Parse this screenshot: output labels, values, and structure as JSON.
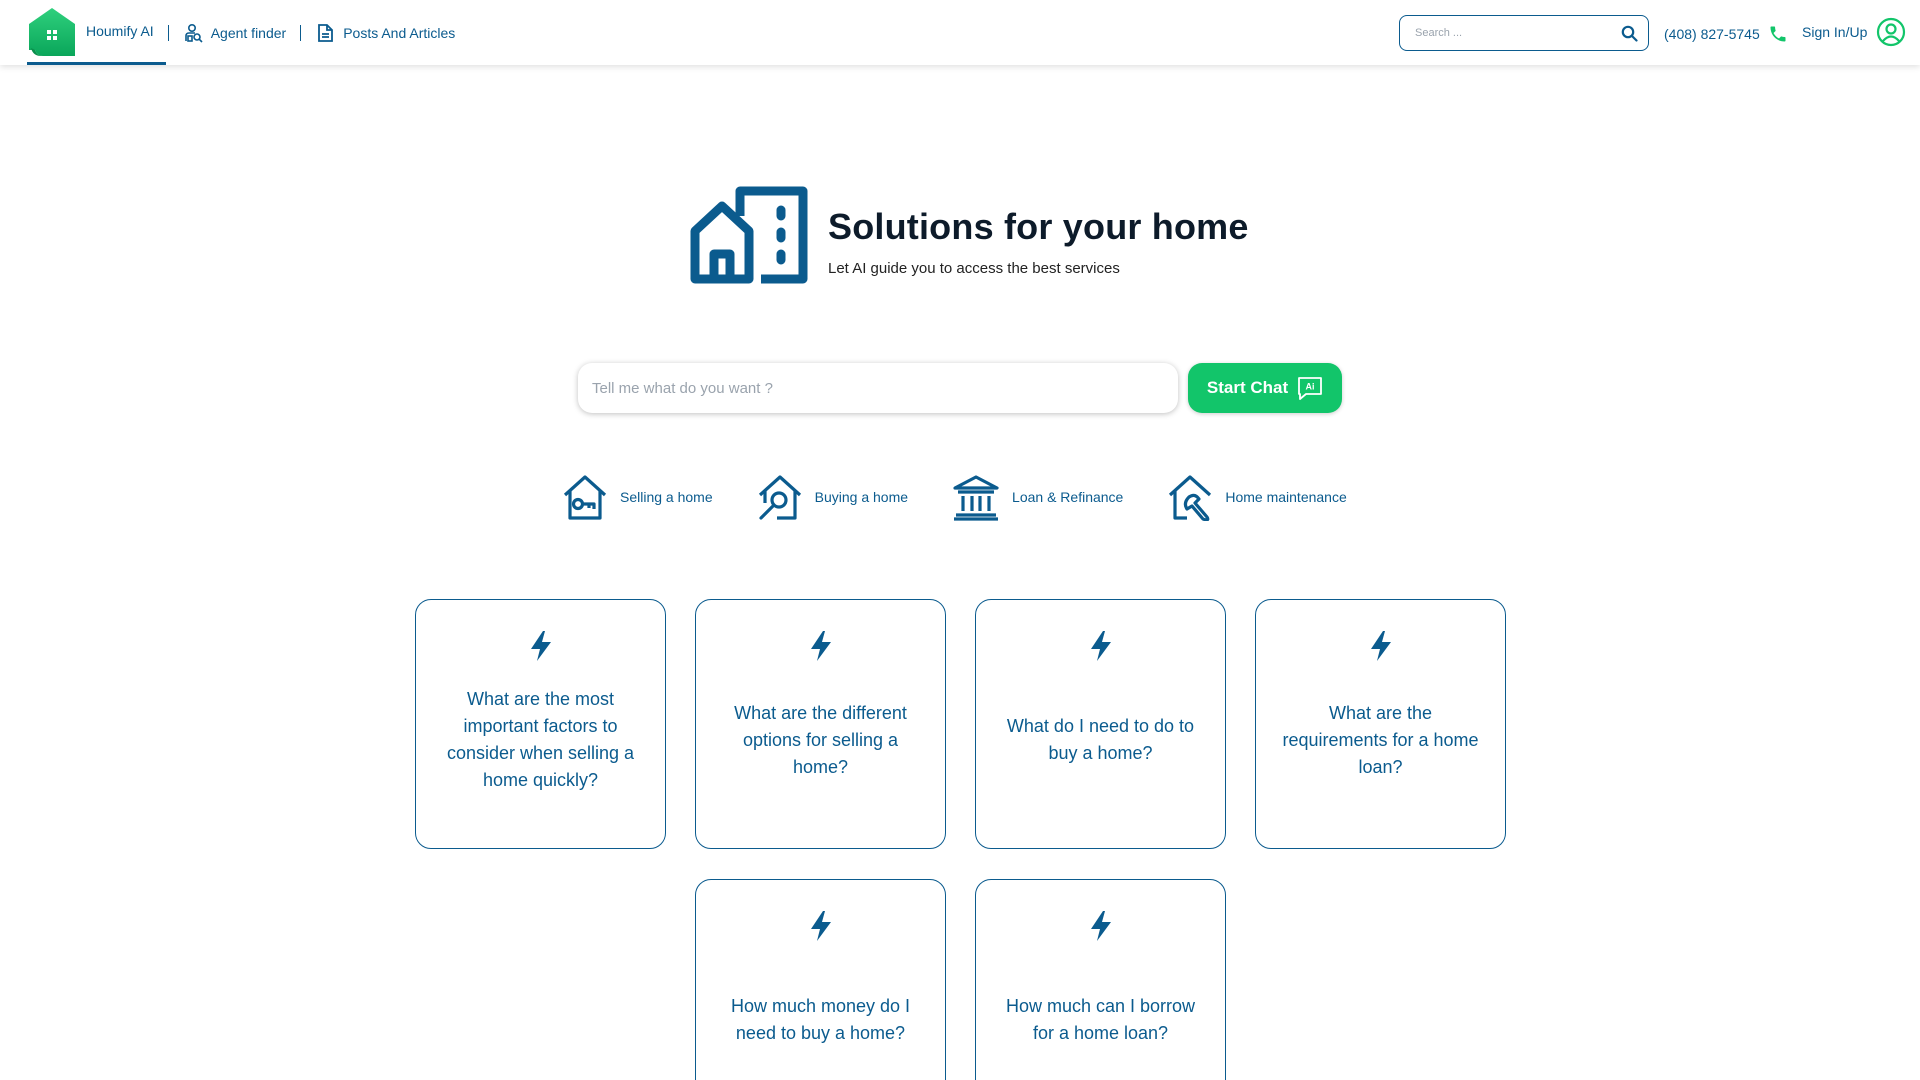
{
  "header": {
    "brand_name": "Houmify AI",
    "nav": [
      {
        "label": "Agent finder",
        "icon": "agent-finder-icon"
      },
      {
        "label": "Posts And Articles",
        "icon": "document-icon"
      }
    ],
    "search_placeholder": "Search ...",
    "phone": "(408) 827-5745",
    "sign_in": "Sign In/Up"
  },
  "hero": {
    "title": "Solutions for your home",
    "subtitle": "Let AI guide you to access the best services"
  },
  "chat": {
    "placeholder": "Tell me what do you want ?",
    "button_label": "Start Chat",
    "button_badge": "Ai"
  },
  "categories": [
    {
      "label": "Selling a home",
      "icon": "house-key-icon"
    },
    {
      "label": "Buying a home",
      "icon": "house-search-icon"
    },
    {
      "label": "Loan & Refinance",
      "icon": "bank-icon"
    },
    {
      "label": "Home maintenance",
      "icon": "house-wrench-icon"
    }
  ],
  "cards": [
    {
      "question": "What are the most important factors to consider when selling a home quickly?"
    },
    {
      "question": "What are the different options for selling a home?"
    },
    {
      "question": "What do I need to do to buy a home?"
    },
    {
      "question": "What are the requirements for a home loan?"
    },
    {
      "question": "How much money do I need to buy a home?"
    },
    {
      "question": "How much can I borrow for a home loan?"
    }
  ],
  "colors": {
    "primary": "#0b5b8e",
    "accent_green": "#12c56a",
    "title_dark": "#0d1b2a"
  }
}
